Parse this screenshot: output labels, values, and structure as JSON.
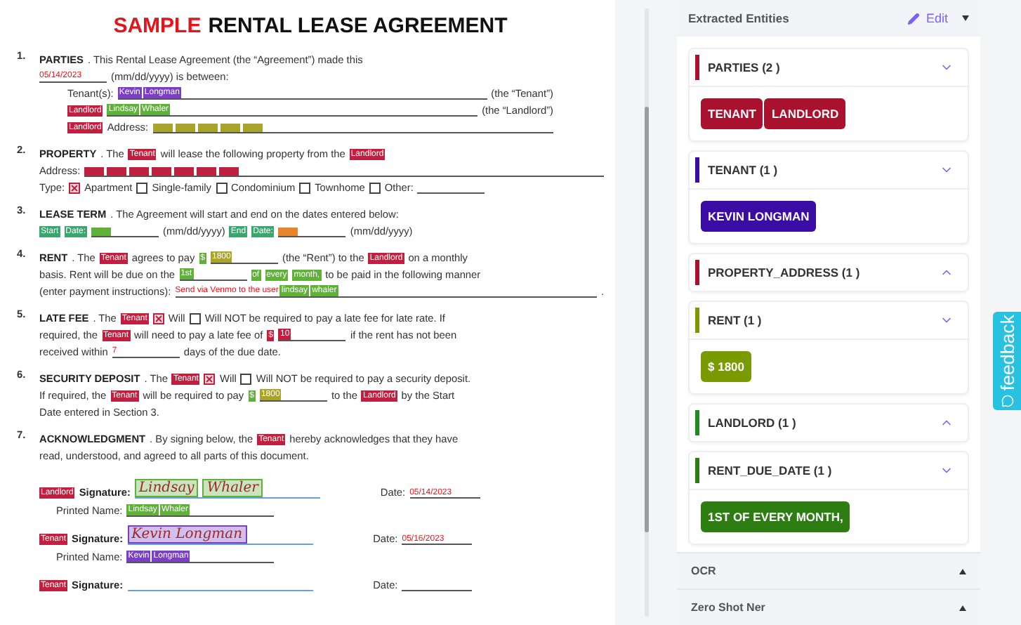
{
  "document": {
    "title": {
      "accent": "SAMPLE",
      "text": "RENTAL LEASE AGREEMENT"
    },
    "sections": [
      {
        "num": "1.",
        "lines": [
          [
            {
              "kind": "bold",
              "t": "PARTIES"
            },
            {
              "kind": "text",
              "t": ". This Rental Lease Agreement (the “Agreement”) made this"
            }
          ],
          [
            {
              "kind": "blank",
              "items": [
                {
                  "kind": "hand",
                  "t": "05/14/2023"
                }
              ]
            },
            {
              "kind": "text",
              "t": "(mm/dd/yyyy) is between:"
            }
          ]
        ],
        "sublines": [
          [
            {
              "kind": "text",
              "t": "Tenant(s):"
            },
            {
              "kind": "fill",
              "items": [
                {
                  "kind": "tag",
                  "t": "Kevin",
                  "color": "#7b3fc4"
                },
                {
                  "kind": "tag",
                  "t": "Longman",
                  "color": "#7b3fc4"
                }
              ]
            },
            {
              "kind": "text",
              "t": "(the “Tenant”)"
            }
          ],
          [
            {
              "kind": "tag",
              "t": "Landlord",
              "color": "#c0203f"
            },
            {
              "kind": "fill",
              "items": [
                {
                  "kind": "tag",
                  "t": "Lindsay",
                  "color": "#5fb13a"
                },
                {
                  "kind": "tag",
                  "t": "Whaler",
                  "color": "#5fb13a"
                }
              ]
            },
            {
              "kind": "text",
              "t": "(the “Landlord”)"
            }
          ],
          [
            {
              "kind": "tag",
              "t": "Landlord",
              "color": "#c0203f"
            },
            {
              "kind": "text",
              "t": "Address:"
            },
            {
              "kind": "fill",
              "items": [
                {
                  "kind": "mark",
                  "color": "#a9a42a"
                },
                {
                  "kind": "mark",
                  "color": "#a9a42a"
                },
                {
                  "kind": "mark",
                  "color": "#a9a42a"
                },
                {
                  "kind": "mark",
                  "color": "#a9a42a"
                },
                {
                  "kind": "mark",
                  "color": "#a9a42a"
                }
              ]
            }
          ]
        ]
      },
      {
        "num": "2.",
        "lines": [
          [
            {
              "kind": "bold",
              "t": "PROPERTY"
            },
            {
              "kind": "text",
              "t": ". The"
            },
            {
              "kind": "tag",
              "t": "Tenant",
              "color": "#c0203f"
            },
            {
              "kind": "text",
              "t": "will lease the following property from the"
            },
            {
              "kind": "tag",
              "t": "Landlord",
              "color": "#c0203f"
            }
          ],
          [
            {
              "kind": "text",
              "t": "Address:"
            },
            {
              "kind": "fill",
              "items": [
                {
                  "kind": "mark",
                  "color": "#c0203f"
                },
                {
                  "kind": "mark",
                  "color": "#c0203f"
                },
                {
                  "kind": "mark",
                  "color": "#c0203f"
                },
                {
                  "kind": "mark",
                  "color": "#c0203f"
                },
                {
                  "kind": "mark",
                  "color": "#c0203f"
                },
                {
                  "kind": "mark",
                  "color": "#c0203f"
                },
                {
                  "kind": "mark",
                  "color": "#c0203f"
                }
              ]
            }
          ],
          [
            {
              "kind": "text",
              "t": "Type:"
            },
            {
              "kind": "box",
              "checked": true
            },
            {
              "kind": "text",
              "t": "Apartment"
            },
            {
              "kind": "box",
              "checked": false
            },
            {
              "kind": "text",
              "t": "Single-family"
            },
            {
              "kind": "box",
              "checked": false
            },
            {
              "kind": "text",
              "t": "Condominium"
            },
            {
              "kind": "box",
              "checked": false
            },
            {
              "kind": "text",
              "t": "Townhome"
            },
            {
              "kind": "box",
              "checked": false
            },
            {
              "kind": "text",
              "t": "Other:"
            },
            {
              "kind": "blank"
            }
          ]
        ]
      },
      {
        "num": "3.",
        "lines": [
          [
            {
              "kind": "bold",
              "t": "LEASE TERM"
            },
            {
              "kind": "text",
              "t": ". The Agreement will start and end on the dates entered below:"
            }
          ],
          [
            {
              "kind": "tag",
              "t": "Start",
              "color": "#3aa56f"
            },
            {
              "kind": "tag",
              "t": "Date:",
              "color": "#3aa56f"
            },
            {
              "kind": "blank",
              "items": [
                {
                  "kind": "mark",
                  "color": "#5fb13a"
                }
              ]
            },
            {
              "kind": "text",
              "t": "(mm/dd/yyyy)"
            },
            {
              "kind": "tag",
              "t": "End",
              "color": "#3aa56f"
            },
            {
              "kind": "tag",
              "t": "Date:",
              "color": "#3aa56f"
            },
            {
              "kind": "blank",
              "items": [
                {
                  "kind": "mark",
                  "color": "#e8842a"
                }
              ]
            },
            {
              "kind": "text",
              "t": "(mm/dd/yyyy)"
            }
          ]
        ]
      },
      {
        "num": "4.",
        "lines": [
          [
            {
              "kind": "bold",
              "t": "RENT"
            },
            {
              "kind": "text",
              "t": ". The"
            },
            {
              "kind": "tag",
              "t": "Tenant",
              "color": "#c0203f"
            },
            {
              "kind": "text",
              "t": "agrees to pay"
            },
            {
              "kind": "tag",
              "t": "$",
              "color": "#5fb13a"
            },
            {
              "kind": "blank",
              "items": [
                {
                  "kind": "tag",
                  "t": "1800",
                  "color": "#a9a42a"
                }
              ]
            },
            {
              "kind": "text",
              "t": "(the “Rent”) to the"
            },
            {
              "kind": "tag",
              "t": "Landlord",
              "color": "#c0203f"
            },
            {
              "kind": "text",
              "t": "on a monthly"
            }
          ],
          [
            {
              "kind": "text",
              "t": "basis. Rent will be due on the"
            },
            {
              "kind": "blank",
              "items": [
                {
                  "kind": "tag",
                  "t": "1st",
                  "color": "#5fb13a"
                }
              ]
            },
            {
              "kind": "tag",
              "t": "of",
              "color": "#5fb13a"
            },
            {
              "kind": "tag",
              "t": "every",
              "color": "#5fb13a"
            },
            {
              "kind": "tag",
              "t": "month,",
              "color": "#5fb13a"
            },
            {
              "kind": "text",
              "t": "to be paid in the following manner"
            }
          ],
          [
            {
              "kind": "text",
              "t": "(enter payment instructions):"
            },
            {
              "kind": "fill",
              "items": [
                {
                  "kind": "hand",
                  "t": "Send via Venmo to the user"
                },
                {
                  "kind": "tag",
                  "t": "lindsay",
                  "color": "#5fb13a"
                },
                {
                  "kind": "tag",
                  "t": "whaler",
                  "color": "#5fb13a"
                }
              ]
            },
            {
              "kind": "text",
              "t": "."
            }
          ]
        ]
      },
      {
        "num": "5.",
        "lines": [
          [
            {
              "kind": "bold",
              "t": "LATE FEE"
            },
            {
              "kind": "text",
              "t": ". The"
            },
            {
              "kind": "tag",
              "t": "Tenant",
              "color": "#c0203f"
            },
            {
              "kind": "box",
              "checked": true
            },
            {
              "kind": "text",
              "t": "Will"
            },
            {
              "kind": "box",
              "checked": false
            },
            {
              "kind": "text",
              "t": "Will NOT be required to pay a late fee for late rate. If"
            }
          ],
          [
            {
              "kind": "text",
              "t": "required, the"
            },
            {
              "kind": "tag",
              "t": "Tenant",
              "color": "#c0203f"
            },
            {
              "kind": "text",
              "t": "will need to pay a late fee of"
            },
            {
              "kind": "tag",
              "t": "$",
              "color": "#c0203f"
            },
            {
              "kind": "blank",
              "items": [
                {
                  "kind": "tag",
                  "t": "10",
                  "color": "#c0203f"
                }
              ]
            },
            {
              "kind": "text",
              "t": "if the rent has not been"
            }
          ],
          [
            {
              "kind": "text",
              "t": "received within"
            },
            {
              "kind": "blank",
              "items": [
                {
                  "kind": "hand",
                  "t": "7"
                }
              ]
            },
            {
              "kind": "text",
              "t": "days of the due date."
            }
          ]
        ]
      },
      {
        "num": "6.",
        "lines": [
          [
            {
              "kind": "bold",
              "t": "SECURITY DEPOSIT"
            },
            {
              "kind": "text",
              "t": ". The"
            },
            {
              "kind": "tag",
              "t": "Tenant",
              "color": "#c0203f"
            },
            {
              "kind": "box",
              "checked": true
            },
            {
              "kind": "text",
              "t": "Will"
            },
            {
              "kind": "box",
              "checked": false
            },
            {
              "kind": "text",
              "t": "Will NOT be required to pay a security deposit."
            }
          ],
          [
            {
              "kind": "text",
              "t": "If required, the"
            },
            {
              "kind": "tag",
              "t": "Tenant",
              "color": "#c0203f"
            },
            {
              "kind": "text",
              "t": "will be required to pay"
            },
            {
              "kind": "tag",
              "t": "$",
              "color": "#5fb13a"
            },
            {
              "kind": "blank",
              "items": [
                {
                  "kind": "tag",
                  "t": "1800",
                  "color": "#a9a42a"
                }
              ]
            },
            {
              "kind": "text",
              "t": "to the"
            },
            {
              "kind": "tag",
              "t": "Landlord",
              "color": "#c0203f"
            },
            {
              "kind": "text",
              "t": "by the Start"
            }
          ],
          [
            {
              "kind": "text",
              "t": "Date entered in Section 3."
            }
          ]
        ]
      },
      {
        "num": "7.",
        "lines": [
          [
            {
              "kind": "bold",
              "t": "ACKNOWLEDGMENT"
            },
            {
              "kind": "text",
              "t": ". By signing below, the"
            },
            {
              "kind": "tag",
              "t": "Tenant",
              "color": "#c0203f"
            },
            {
              "kind": "text",
              "t": "hereby acknowledges that they have"
            }
          ],
          [
            {
              "kind": "text",
              "t": "read, understood, and agreed to all parts of this document."
            }
          ]
        ]
      }
    ],
    "signatures": [
      {
        "role": {
          "t": "Landlord",
          "color": "#c0203f"
        },
        "label": "Signature:",
        "signature": {
          "color": "#5fb13a",
          "parts": [
            "Lindsay",
            "Whaler"
          ]
        },
        "date_label": "Date:",
        "date": "05/14/2023",
        "printed_label": "Printed Name:",
        "printed": {
          "color": "#5fb13a",
          "parts": [
            "Lindsay",
            "Whaler"
          ]
        }
      },
      {
        "role": {
          "t": "Tenant",
          "color": "#c0203f"
        },
        "label": "Signature:",
        "signature": {
          "color": "#7b3fc4",
          "parts": [
            "Kevin Longman"
          ]
        },
        "date_label": "Date:",
        "date": "05/16/2023",
        "printed_label": "Printed Name:",
        "printed": {
          "color": "#7b3fc4",
          "parts": [
            "Kevin",
            "Longman"
          ]
        }
      },
      {
        "role": {
          "t": "Tenant",
          "color": "#c0203f"
        },
        "label": "Signature:",
        "date_label": "Date:"
      }
    ]
  },
  "panel": {
    "title": "Extracted Entities",
    "edit": "Edit",
    "entities": [
      {
        "name": "PARTIES (2 )",
        "color": "#a8122f",
        "expanded": true,
        "values": [
          "TENANT",
          "LANDLORD"
        ]
      },
      {
        "name": "TENANT (1 )",
        "color": "#3a0ca3",
        "expanded": true,
        "values": [
          "KEVIN LONGMAN"
        ]
      },
      {
        "name": "PROPERTY_ADDRESS (1 )",
        "color": "#a8122f",
        "expanded": false
      },
      {
        "name": "RENT (1 )",
        "color": "#7a9a01",
        "expanded": true,
        "values": [
          "$ 1800"
        ]
      },
      {
        "name": "LANDLORD (1 )",
        "color": "#1f8a1f",
        "expanded": false
      },
      {
        "name": "RENT_DUE_DATE (1 )",
        "color": "#2e7d12",
        "expanded": true,
        "values": [
          "1ST OF EVERY MONTH,"
        ]
      }
    ],
    "sections": [
      {
        "title": "OCR"
      },
      {
        "title": "Zero Shot Ner"
      }
    ]
  },
  "feedback": "feedback"
}
